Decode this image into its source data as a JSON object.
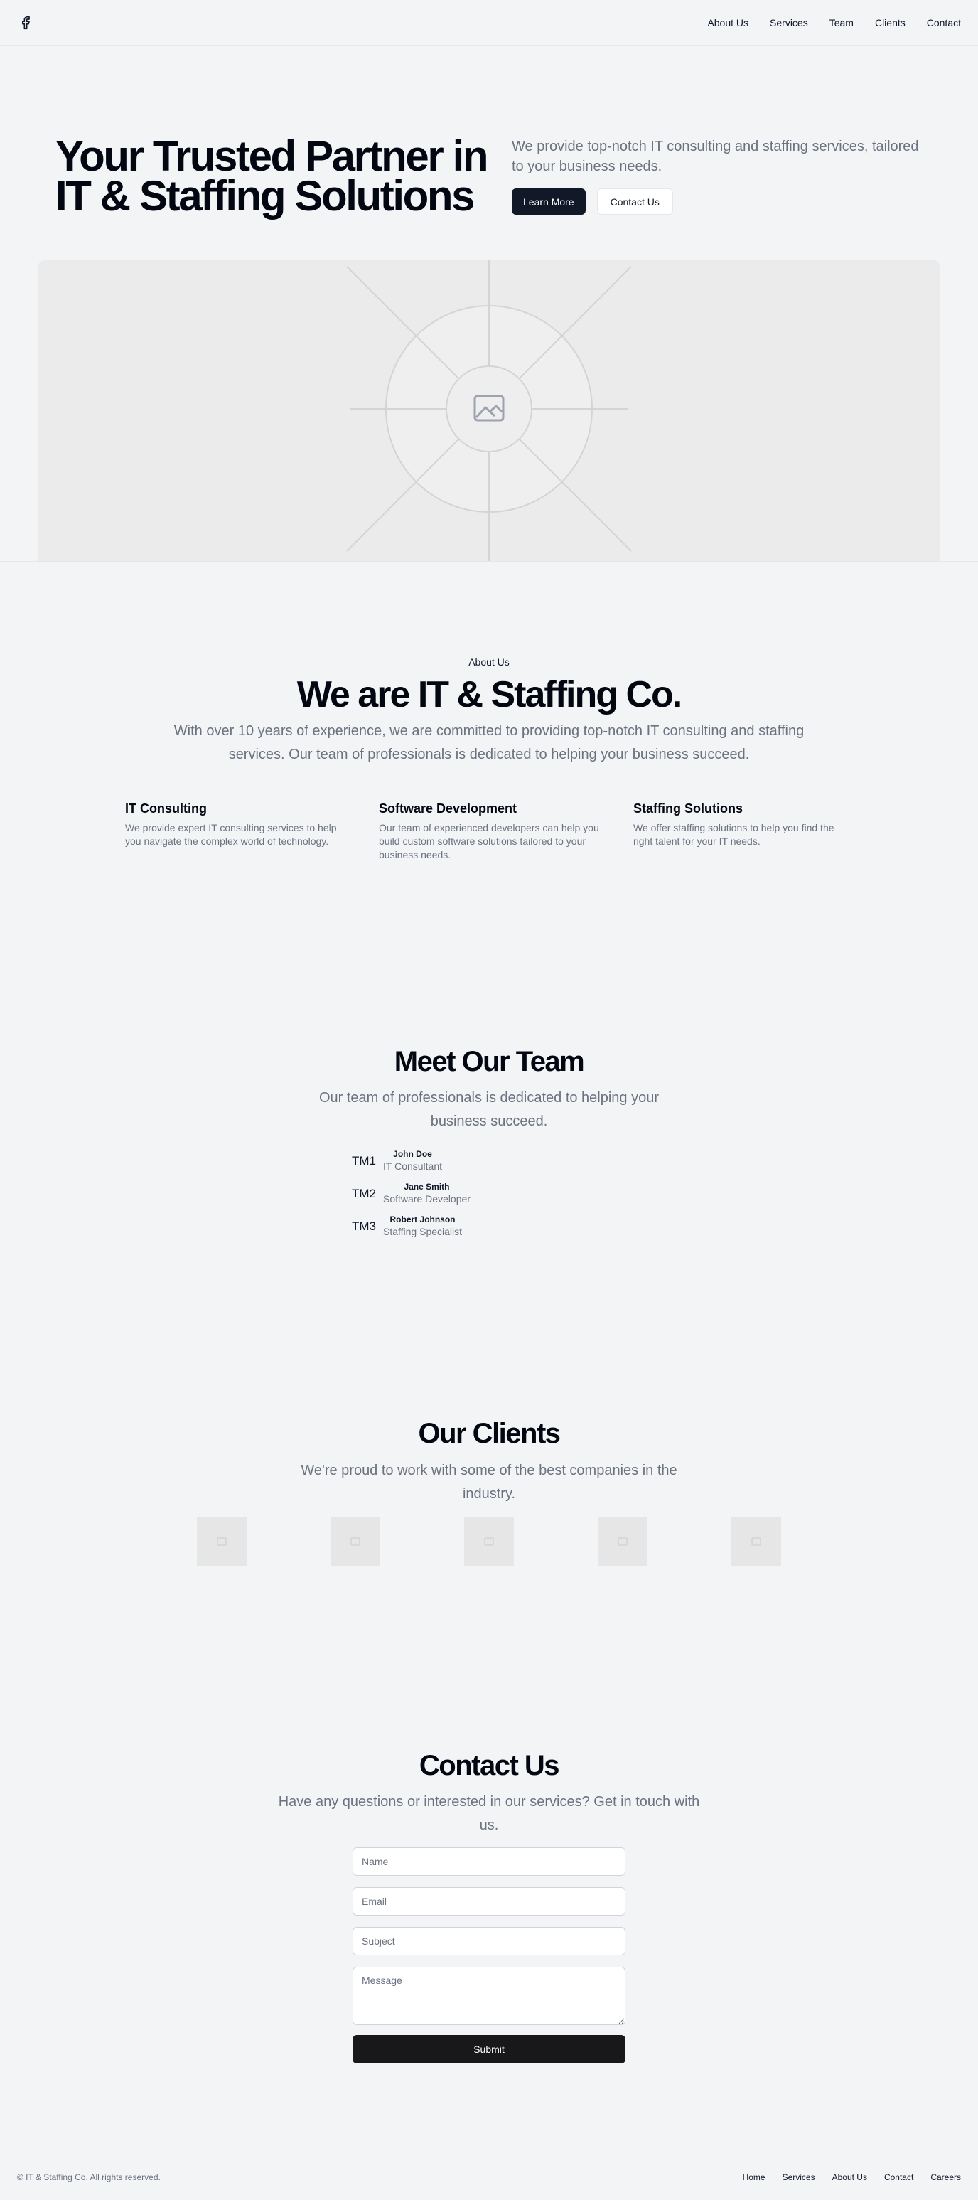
{
  "header": {
    "logo_icon": "facebook-icon",
    "nav": [
      "About Us",
      "Services",
      "Team",
      "Clients",
      "Contact"
    ]
  },
  "hero": {
    "title": "Your Trusted Partner in IT & Staffing Solutions",
    "text": "We provide top-notch IT consulting and staffing services, tailored to your business needs.",
    "primary_button": "Learn More",
    "secondary_button": "Contact Us",
    "image_icon": "image-placeholder-icon"
  },
  "about": {
    "eyebrow": "About Us",
    "title": "We are IT & Staffing Co.",
    "text": "With over 10 years of experience, we are committed to providing top-notch IT consulting and staffing services. Our team of professionals is dedicated to helping your business succeed.",
    "features": [
      {
        "title": "IT Consulting",
        "text": "We provide expert IT consulting services to help you navigate the complex world of technology."
      },
      {
        "title": "Software Development",
        "text": "Our team of experienced developers can help you build custom software solutions tailored to your business needs."
      },
      {
        "title": "Staffing Solutions",
        "text": "We offer staffing solutions to help you find the right talent for your IT needs."
      }
    ]
  },
  "team": {
    "title": "Meet Our Team",
    "text": "Our team of professionals is dedicated to helping your business succeed.",
    "members": [
      {
        "avatar": "TM1",
        "name": "John Doe",
        "role": "IT Consultant"
      },
      {
        "avatar": "TM2",
        "name": "Jane Smith",
        "role": "Software Developer"
      },
      {
        "avatar": "TM3",
        "name": "Robert Johnson",
        "role": "Staffing Specialist"
      }
    ]
  },
  "clients": {
    "title": "Our Clients",
    "text": "We're proud to work with some of the best companies in the industry.",
    "logo_count": 5
  },
  "contact": {
    "title": "Contact Us",
    "text": "Have any questions or interested in our services? Get in touch with us.",
    "name_placeholder": "Name",
    "email_placeholder": "Email",
    "subject_placeholder": "Subject",
    "message_placeholder": "Message",
    "submit_label": "Submit"
  },
  "footer": {
    "copyright": "© IT & Staffing Co. All rights reserved.",
    "nav": [
      "Home",
      "Services",
      "About Us",
      "Contact",
      "Careers"
    ]
  },
  "colors": {
    "background": "#f3f4f6",
    "primary_button": "#111827",
    "submit_button": "#18181b",
    "muted_text": "#6b7280"
  }
}
